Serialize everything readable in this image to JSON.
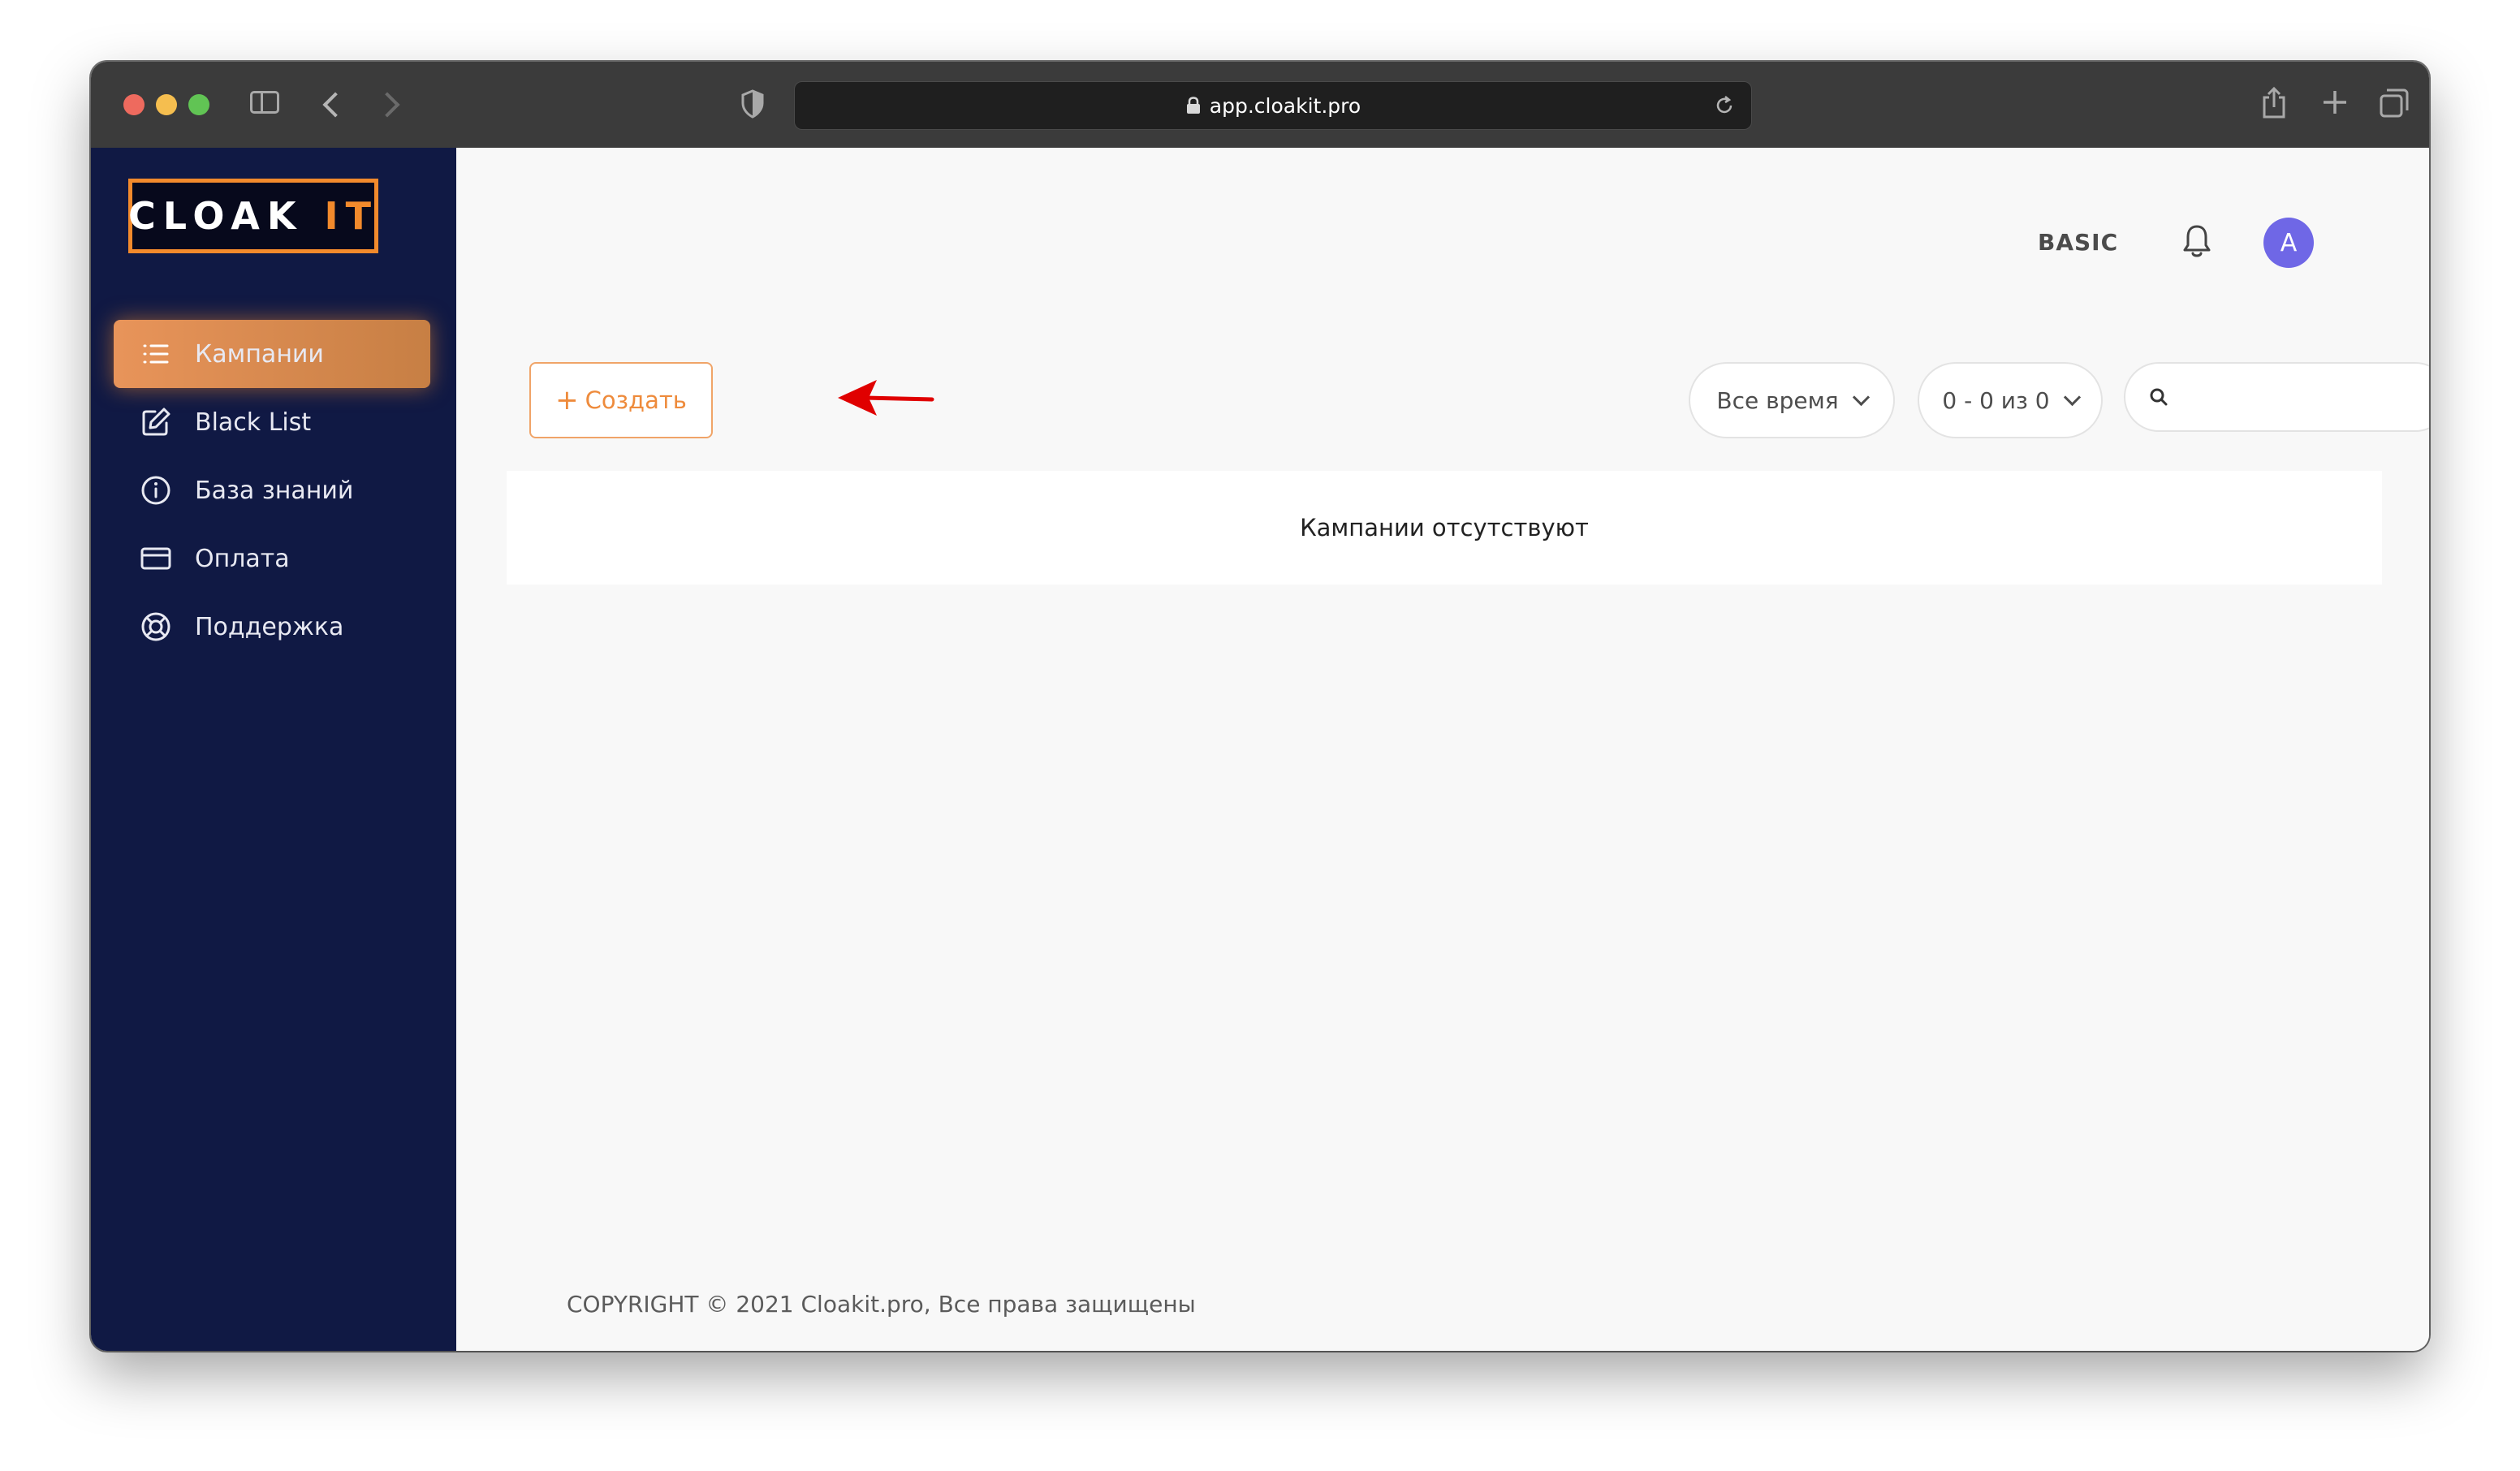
{
  "browser": {
    "url": "app.cloakit.pro"
  },
  "sidebar": {
    "logo": {
      "main": "CLOAK",
      "accent": "IT"
    },
    "items": [
      {
        "label": "Кампании",
        "icon": "list-icon",
        "active": true
      },
      {
        "label": "Black List",
        "icon": "edit-icon",
        "active": false
      },
      {
        "label": "База знаний",
        "icon": "info-icon",
        "active": false
      },
      {
        "label": "Оплата",
        "icon": "credit-card-icon",
        "active": false
      },
      {
        "label": "Поддержка",
        "icon": "lifebuoy-icon",
        "active": false
      }
    ]
  },
  "header": {
    "plan": "BASIC",
    "avatar_letter": "A"
  },
  "toolbar": {
    "create_label": "Создать",
    "time_filter": "Все время",
    "range": "0 - 0 из 0",
    "search_value": ""
  },
  "content": {
    "empty_message": "Кампании отсутствуют"
  },
  "footer": {
    "copyright": "COPYRIGHT © 2021 Cloakit.pro, Все права защищены"
  },
  "colors": {
    "sidebar_bg": "#101944",
    "accent_orange": "#f28a2c",
    "avatar": "#6f67e6",
    "annotation_arrow": "#e00000"
  }
}
